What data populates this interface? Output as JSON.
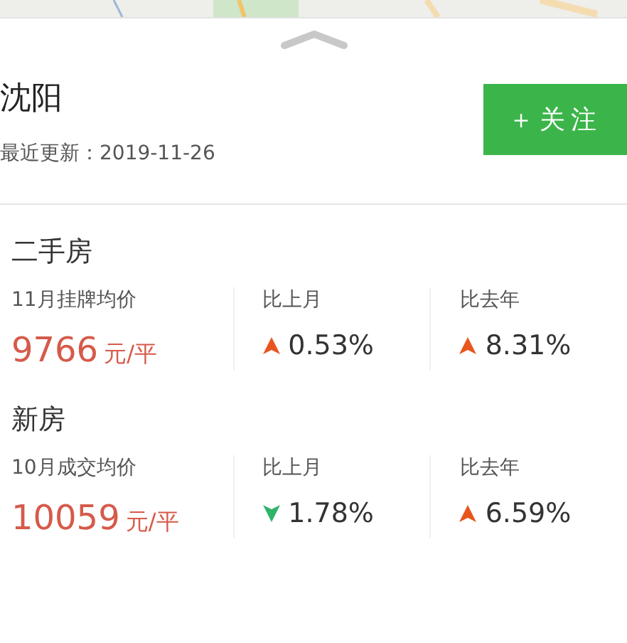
{
  "header": {
    "city": "沈阳",
    "updated": "最近更新：2019-11-26",
    "follow_button": "＋关注"
  },
  "sections": [
    {
      "title": "二手房",
      "price_label": "11月挂牌均价",
      "price": "9766",
      "unit": "元/平",
      "changes": [
        {
          "label": "比上月",
          "kind": "up",
          "value": "0.53%"
        },
        {
          "label": "比去年",
          "kind": "up",
          "value": "8.31%"
        }
      ]
    },
    {
      "title": "新房",
      "price_label": "10月成交均价",
      "price": "10059",
      "unit": "元/平",
      "changes": [
        {
          "label": "比上月",
          "kind": "down",
          "value": "1.78%"
        },
        {
          "label": "比去年",
          "kind": "up",
          "value": "6.59%"
        }
      ]
    }
  ]
}
